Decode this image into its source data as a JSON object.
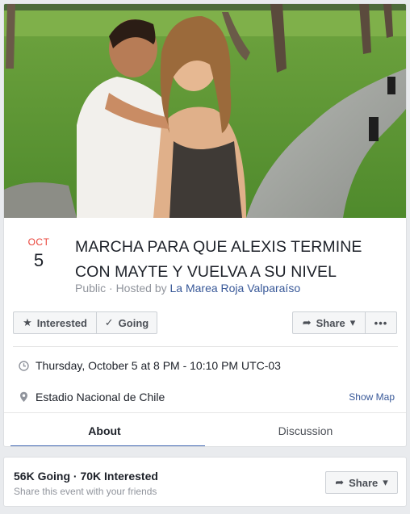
{
  "event": {
    "month": "OCT",
    "day": "5",
    "title": "MARCHA PARA QUE ALEXIS TERMINE CON MAYTE Y VUELVA A SU NIVEL",
    "visibility": "Public · Hosted by",
    "host": "La Marea Roja Valparaíso"
  },
  "actions": {
    "interested_label": "Interested",
    "going_label": "Going",
    "share_label": "Share",
    "more_label": "•••"
  },
  "details": {
    "datetime": "Thursday, October 5 at 8 PM - 10:10 PM UTC-03",
    "location": "Estadio Nacional de Chile",
    "show_map": "Show Map"
  },
  "tabs": [
    {
      "label": "About",
      "active": true
    },
    {
      "label": "Discussion",
      "active": false
    }
  ],
  "summary": {
    "stats": "56K Going · 70K Interested",
    "subtitle": "Share this event with your friends",
    "share_label": "Share"
  },
  "icons": {
    "interested": "star-icon",
    "going": "checkmark-icon",
    "share": "share-arrow-icon",
    "dropdown": "caret-down-icon",
    "clock": "clock-icon",
    "location": "map-pin-icon"
  },
  "colors": {
    "accent": "#4267b2",
    "link": "#385898",
    "month": "#e9443a",
    "muted": "#90949c"
  }
}
